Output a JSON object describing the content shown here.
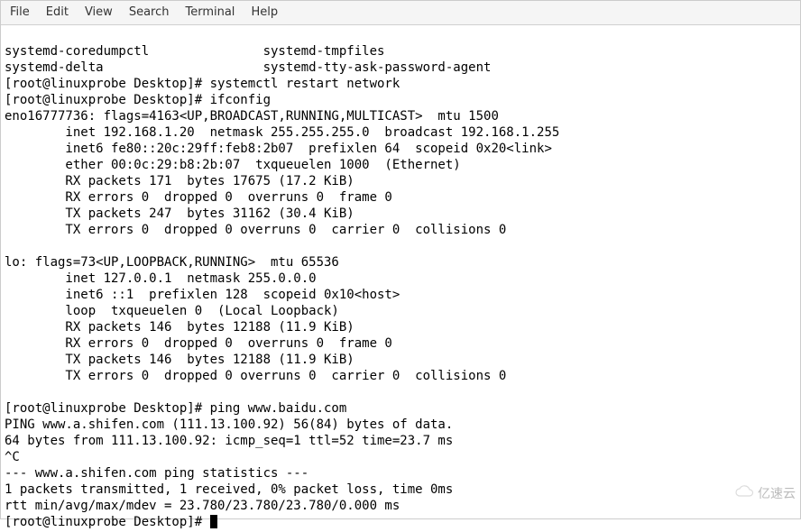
{
  "menubar": {
    "items": [
      "File",
      "Edit",
      "View",
      "Search",
      "Terminal",
      "Help"
    ]
  },
  "terminal": {
    "lines": [
      "systemd-coredumpctl               systemd-tmpfiles",
      "systemd-delta                     systemd-tty-ask-password-agent",
      "[root@linuxprobe Desktop]# systemctl restart network",
      "[root@linuxprobe Desktop]# ifconfig",
      "eno16777736: flags=4163<UP,BROADCAST,RUNNING,MULTICAST>  mtu 1500",
      "        inet 192.168.1.20  netmask 255.255.255.0  broadcast 192.168.1.255",
      "        inet6 fe80::20c:29ff:feb8:2b07  prefixlen 64  scopeid 0x20<link>",
      "        ether 00:0c:29:b8:2b:07  txqueuelen 1000  (Ethernet)",
      "        RX packets 171  bytes 17675 (17.2 KiB)",
      "        RX errors 0  dropped 0  overruns 0  frame 0",
      "        TX packets 247  bytes 31162 (30.4 KiB)",
      "        TX errors 0  dropped 0 overruns 0  carrier 0  collisions 0",
      "",
      "lo: flags=73<UP,LOOPBACK,RUNNING>  mtu 65536",
      "        inet 127.0.0.1  netmask 255.0.0.0",
      "        inet6 ::1  prefixlen 128  scopeid 0x10<host>",
      "        loop  txqueuelen 0  (Local Loopback)",
      "        RX packets 146  bytes 12188 (11.9 KiB)",
      "        RX errors 0  dropped 0  overruns 0  frame 0",
      "        TX packets 146  bytes 12188 (11.9 KiB)",
      "        TX errors 0  dropped 0 overruns 0  carrier 0  collisions 0",
      "",
      "[root@linuxprobe Desktop]# ping www.baidu.com",
      "PING www.a.shifen.com (111.13.100.92) 56(84) bytes of data.",
      "64 bytes from 111.13.100.92: icmp_seq=1 ttl=52 time=23.7 ms",
      "^C",
      "--- www.a.shifen.com ping statistics ---",
      "1 packets transmitted, 1 received, 0% packet loss, time 0ms",
      "rtt min/avg/max/mdev = 23.780/23.780/23.780/0.000 ms"
    ],
    "prompt_last": "[root@linuxprobe Desktop]# "
  },
  "watermark": {
    "text": "亿速云"
  }
}
